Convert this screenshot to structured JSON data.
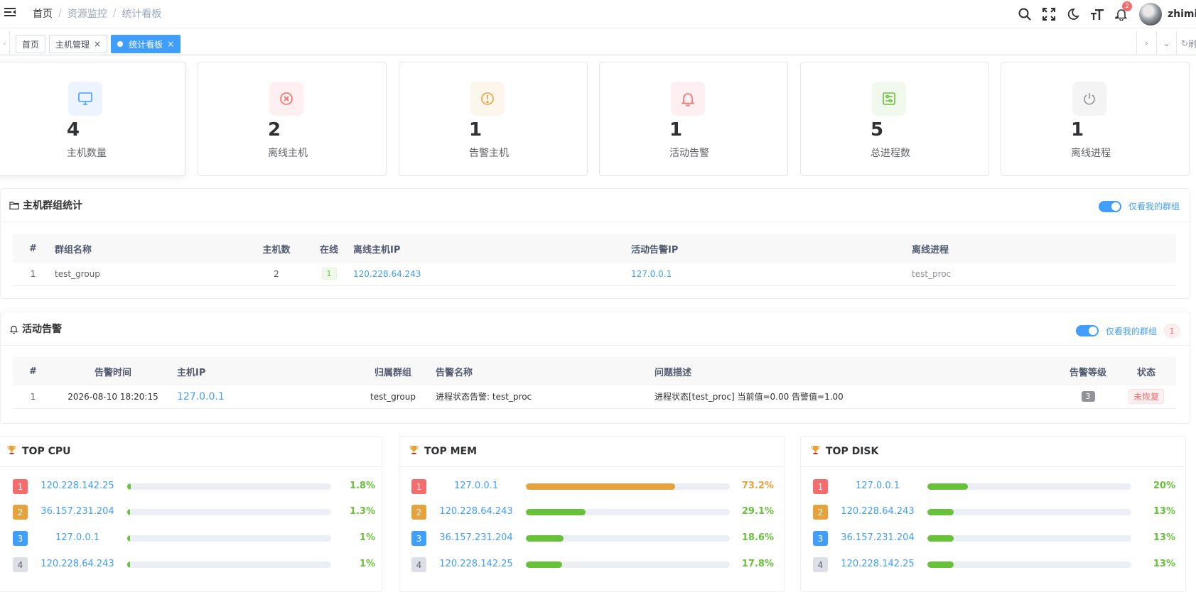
{
  "navbar": {
    "breadcrumb": [
      "首页",
      "资源监控",
      "统计看板"
    ],
    "notification_count": "2",
    "username": "zhimin"
  },
  "tags": [
    {
      "label": "首页",
      "active": false,
      "closable": false
    },
    {
      "label": "主机管理",
      "active": false,
      "closable": true
    },
    {
      "label": "统计看板",
      "active": true,
      "closable": true
    }
  ],
  "tags_refresh_label": "刷新",
  "stats": [
    {
      "value": "4",
      "label": "主机数量",
      "icon": "monitor-icon",
      "bg": "#ecf5ff",
      "color": "#409eff"
    },
    {
      "value": "2",
      "label": "离线主机",
      "icon": "circle-x-icon",
      "bg": "#fef0f0",
      "color": "#f56c6c"
    },
    {
      "value": "1",
      "label": "告警主机",
      "icon": "warning-circle-icon",
      "bg": "#fdf6ec",
      "color": "#e6a23c"
    },
    {
      "value": "1",
      "label": "活动告警",
      "icon": "bell-icon",
      "bg": "#fef0f0",
      "color": "#f56c6c"
    },
    {
      "value": "5",
      "label": "总进程数",
      "icon": "process-icon",
      "bg": "#f0f9eb",
      "color": "#67c23a"
    },
    {
      "value": "1",
      "label": "离线进程",
      "icon": "power-icon",
      "bg": "#f4f4f5",
      "color": "#909399"
    }
  ],
  "group_panel": {
    "title": "主机群组统计",
    "switch_label": "仅看我的群组",
    "columns": [
      "#",
      "群组名称",
      "主机数",
      "在线",
      "离线主机IP",
      "活动告警IP",
      "离线进程"
    ],
    "rows": [
      {
        "idx": "1",
        "name": "test_group",
        "hosts": "2",
        "online": "1",
        "offline_ip": "120.228.64.243",
        "alert_ip": "127.0.0.1",
        "offline_proc": "test_proc"
      }
    ]
  },
  "alert_panel": {
    "title": "活动告警",
    "switch_label": "仅看我的群组",
    "count": "1",
    "columns": [
      "#",
      "告警时间",
      "主机IP",
      "归属群组",
      "告警名称",
      "问题描述",
      "告警等级",
      "状态"
    ],
    "rows": [
      {
        "idx": "1",
        "time": "2026-08-10 18:20:15",
        "ip": "127.0.0.1",
        "group": "test_group",
        "name": "进程状态告警: test_proc",
        "desc": "进程状态[test_proc] 当前值=0.00 告警值=1.00",
        "level": "3",
        "status": "未恢复"
      }
    ]
  },
  "top_panels": [
    {
      "title": "TOP CPU",
      "items": [
        {
          "rank": "1",
          "ip": "120.228.142.25",
          "value": "1.8%",
          "pct": 1.8,
          "color": "#67c23a"
        },
        {
          "rank": "2",
          "ip": "36.157.231.204",
          "value": "1.3%",
          "pct": 1.3,
          "color": "#67c23a"
        },
        {
          "rank": "3",
          "ip": "127.0.0.1",
          "value": "1%",
          "pct": 1,
          "color": "#67c23a"
        },
        {
          "rank": "4",
          "ip": "120.228.64.243",
          "value": "1%",
          "pct": 1,
          "color": "#67c23a"
        }
      ]
    },
    {
      "title": "TOP MEM",
      "items": [
        {
          "rank": "1",
          "ip": "127.0.0.1",
          "value": "73.2%",
          "pct": 73.2,
          "color": "#e6a23c"
        },
        {
          "rank": "2",
          "ip": "120.228.64.243",
          "value": "29.1%",
          "pct": 29.1,
          "color": "#67c23a"
        },
        {
          "rank": "3",
          "ip": "36.157.231.204",
          "value": "18.6%",
          "pct": 18.6,
          "color": "#67c23a"
        },
        {
          "rank": "4",
          "ip": "120.228.142.25",
          "value": "17.8%",
          "pct": 17.8,
          "color": "#67c23a"
        }
      ]
    },
    {
      "title": "TOP DISK",
      "items": [
        {
          "rank": "1",
          "ip": "127.0.0.1",
          "value": "20%",
          "pct": 20,
          "color": "#67c23a"
        },
        {
          "rank": "2",
          "ip": "120.228.64.243",
          "value": "13%",
          "pct": 13,
          "color": "#67c23a"
        },
        {
          "rank": "3",
          "ip": "36.157.231.204",
          "value": "13%",
          "pct": 13,
          "color": "#67c23a"
        },
        {
          "rank": "4",
          "ip": "120.228.142.25",
          "value": "13%",
          "pct": 13,
          "color": "#67c23a"
        }
      ]
    }
  ]
}
